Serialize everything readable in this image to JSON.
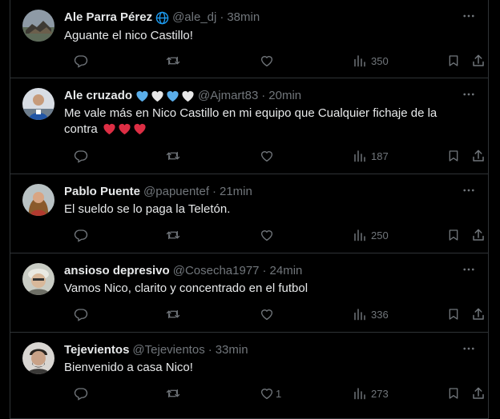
{
  "tweets": [
    {
      "name": "Ale Parra Pérez",
      "handle": "@ale_dj",
      "time": "38min",
      "text": "Aguante el nico Castillo!",
      "likes": "",
      "views": "350"
    },
    {
      "name": "Ale cruzado",
      "handle": "@Ajmart83",
      "time": "20min",
      "text": "Me vale más en Nico Castillo en mi equipo que Cualquier fichaje de la contra",
      "likes": "",
      "views": "187"
    },
    {
      "name": "Pablo Puente",
      "handle": "@papuentef",
      "time": "21min",
      "text": "El sueldo se lo paga la Teletón.",
      "likes": "",
      "views": "250"
    },
    {
      "name": "ansioso depresivo",
      "handle": "@Cosecha1977",
      "time": "24min",
      "text": "Vamos Nico, clarito y concentrado en el futbol",
      "likes": "",
      "views": "336"
    },
    {
      "name": "Tejevientos",
      "handle": "@Tejevientos",
      "time": "33min",
      "text": "Bienvenido a casa Nico!",
      "likes": "1",
      "views": "273"
    }
  ],
  "separator": "·",
  "icons": {
    "more": "more-icon",
    "reply": "reply-icon",
    "retweet": "retweet-icon",
    "like": "heart-icon",
    "views": "views-icon",
    "bookmark": "bookmark-icon",
    "share": "share-icon",
    "verified": "globe-icon"
  },
  "colors": {
    "background": "#000000",
    "text": "#e7e9ea",
    "muted": "#71767b",
    "border": "#2f3336",
    "blue_heart": "#5aaeea",
    "red_heart": "#dd2e44"
  }
}
